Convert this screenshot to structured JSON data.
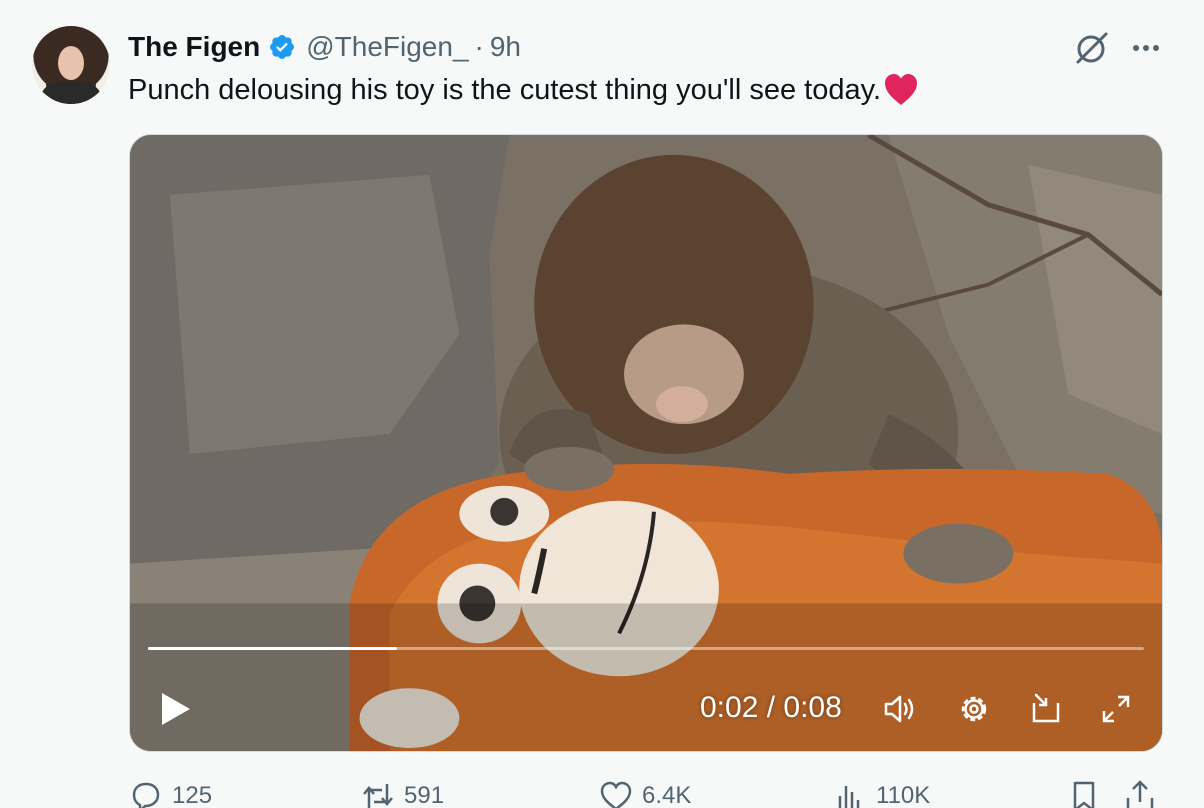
{
  "author": {
    "name": "The Figen",
    "handle": "@TheFigen_",
    "separator": "·",
    "time": "9h",
    "verified_color": "#1d9bf0"
  },
  "tweet": {
    "text": "Punch delousing his toy is the cutest thing you'll see today.",
    "emoji": "red-heart"
  },
  "video": {
    "time_display": "0:02 / 0:08",
    "progress_fraction": 0.25
  },
  "actions": {
    "replies": "125",
    "reposts": "591",
    "likes": "6.4K",
    "views": "110K"
  },
  "colors": {
    "text_secondary": "#536471",
    "heart": "#e0245e",
    "background": "#f7f9f9"
  },
  "icons": [
    "verified-badge-icon",
    "grok-icon",
    "more-icon",
    "play-icon",
    "volume-icon",
    "settings-icon",
    "pip-icon",
    "fullscreen-icon",
    "reply-icon",
    "repost-icon",
    "like-icon",
    "views-icon",
    "bookmark-icon",
    "share-icon"
  ]
}
